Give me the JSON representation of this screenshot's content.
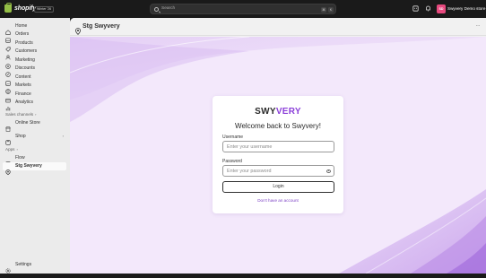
{
  "topbar": {
    "brand": "shopify",
    "edition_badge": "Winter '26",
    "search_placeholder": "Search",
    "search_shortcut_1": "⌘",
    "search_shortcut_2": "K",
    "store_initials": "SD",
    "store_name": "Swyvery Demo store"
  },
  "sidebar": {
    "items": [
      {
        "label": "Home",
        "icon": "home-icon"
      },
      {
        "label": "Orders",
        "icon": "orders-icon"
      },
      {
        "label": "Products",
        "icon": "products-icon"
      },
      {
        "label": "Customers",
        "icon": "customers-icon"
      },
      {
        "label": "Marketing",
        "icon": "marketing-icon"
      },
      {
        "label": "Discounts",
        "icon": "discounts-icon"
      },
      {
        "label": "Content",
        "icon": "content-icon"
      },
      {
        "label": "Markets",
        "icon": "markets-icon"
      },
      {
        "label": "Finance",
        "icon": "finance-icon"
      },
      {
        "label": "Analytics",
        "icon": "analytics-icon"
      }
    ],
    "sales_channels_label": "Sales channels",
    "online_store": "Online Store",
    "shop": "Shop",
    "apps_label": "Apps",
    "flow": "Flow",
    "stg_swyvery": "Stg Swyvery",
    "settings": "Settings"
  },
  "app": {
    "title": "Stg Swyvery",
    "more": "···"
  },
  "login": {
    "brand_part1": "SWY",
    "brand_part2": "VERY",
    "welcome": "Welcome back to Swyvery!",
    "username_label": "Username",
    "username_placeholder": "Enter your username",
    "password_label": "Password",
    "password_placeholder": "Enter your password",
    "login_button": "Login",
    "signup_link": "Don't have an account"
  },
  "colors": {
    "accent": "#8b3fd9",
    "canvas_bg": "#f3e8fb",
    "avatar": "#e84a7f",
    "topbar": "#1a1a1a"
  }
}
